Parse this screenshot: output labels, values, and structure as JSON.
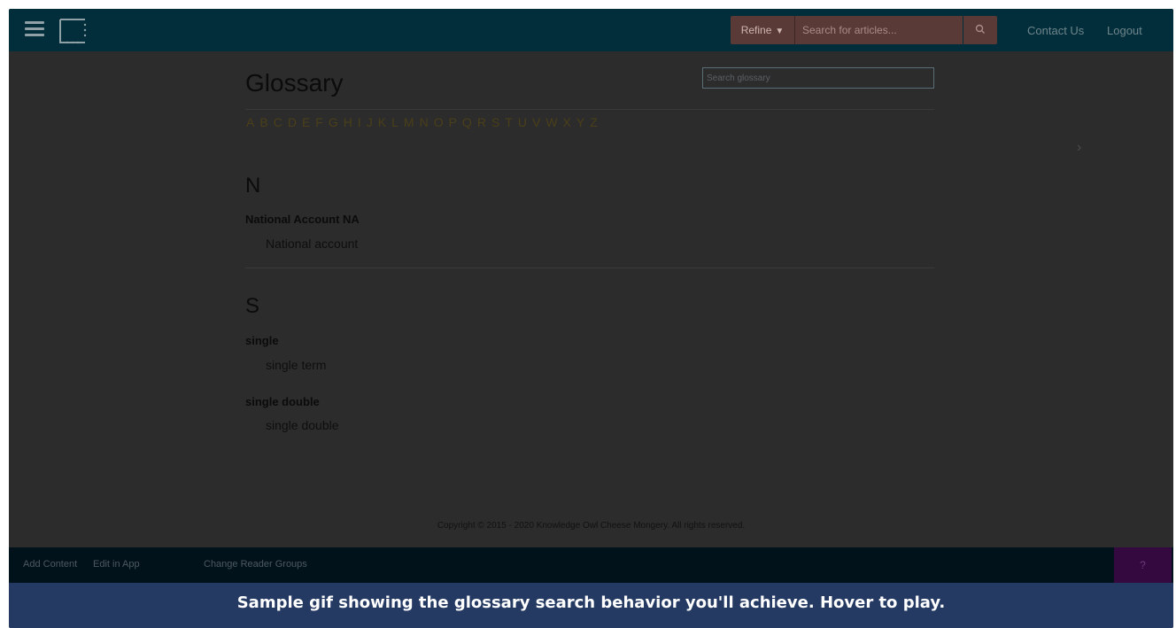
{
  "topbar": {
    "refine_label": "Refine",
    "search_placeholder": "Search for articles...",
    "contact_label": "Contact Us",
    "logout_label": "Logout",
    "icons": [
      "hamburger-menu-icon",
      "logo-icon",
      "caret-down-icon",
      "search-icon"
    ]
  },
  "main": {
    "title": "Glossary",
    "search_placeholder": "Search glossary",
    "alphabet": [
      "A",
      "B",
      "C",
      "D",
      "E",
      "F",
      "G",
      "H",
      "I",
      "J",
      "K",
      "L",
      "M",
      "N",
      "O",
      "P",
      "Q",
      "R",
      "S",
      "T",
      "U",
      "V",
      "W",
      "X",
      "Y",
      "Z"
    ],
    "next_arrow": "›",
    "sections": [
      {
        "letter": "N",
        "entries": [
          {
            "term": "National Account NA",
            "definition": "National account"
          }
        ]
      },
      {
        "letter": "S",
        "entries": [
          {
            "term": "single",
            "definition": "single term"
          },
          {
            "term": "single double",
            "definition": "single double"
          }
        ]
      }
    ],
    "copyright": "Copyright © 2015 - 2020 Knowledge Owl Cheese Mongery. All rights reserved."
  },
  "adminbar": {
    "add_content": "Add Content",
    "edit_in_app": "Edit in App",
    "change_reader_groups": "Change Reader Groups",
    "help_label": "?"
  },
  "caption": "Sample gif showing the glossary search behavior you'll achieve. Hover to play.",
  "colors": {
    "overlay_bg": "#2c2c2c",
    "topbar_bg": "#012e3a",
    "search_bg": "#5a3a36",
    "adminbar_bg": "#02121a",
    "help_bg": "#34093f",
    "caption_bg": "#253a63"
  }
}
